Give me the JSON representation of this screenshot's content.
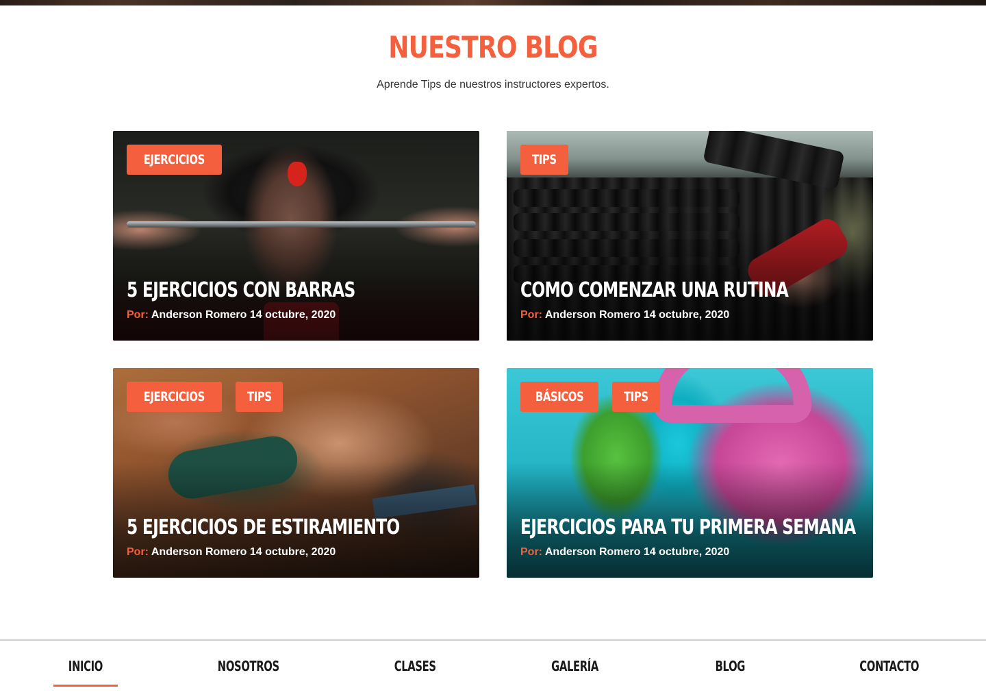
{
  "blog": {
    "title": "NUESTRO BLOG",
    "subtitle": "Aprende Tips de nuestros instructores expertos."
  },
  "posts": [
    {
      "tags": [
        "EJERCICIOS"
      ],
      "title": "5 EJERCICIOS CON BARRAS",
      "by_label": "Por:",
      "author_date": "Anderson Romero 14 octubre, 2020",
      "image": "barbell-bench-press-photo"
    },
    {
      "tags": [
        "TIPS"
      ],
      "title": "COMO COMENZAR UNA RUTINA",
      "by_label": "Por:",
      "author_date": "Anderson Romero 14 octubre, 2020",
      "image": "dumbbell-rack-gym-photo"
    },
    {
      "tags": [
        "EJERCICIOS",
        "TIPS"
      ],
      "title": "5 EJERCICIOS DE ESTIRAMIENTO",
      "by_label": "Por:",
      "author_date": "Anderson Romero 14 octubre, 2020",
      "image": "stretching-class-photo"
    },
    {
      "tags": [
        "BÁSICOS",
        "TIPS"
      ],
      "title": "EJERCICIOS PARA TU PRIMERA SEMANA",
      "by_label": "Por:",
      "author_date": "Anderson Romero 14 octubre, 2020",
      "image": "colorful-kettlebells-photo"
    }
  ],
  "nav": {
    "items": [
      "INICIO",
      "NOSOTROS",
      "CLASES",
      "GALERÍA",
      "BLOG",
      "CONTACTO"
    ],
    "active": "INICIO"
  },
  "colors": {
    "accent": "#f4603d",
    "nav_text": "#1a1a1a",
    "background": "#ffffff"
  }
}
